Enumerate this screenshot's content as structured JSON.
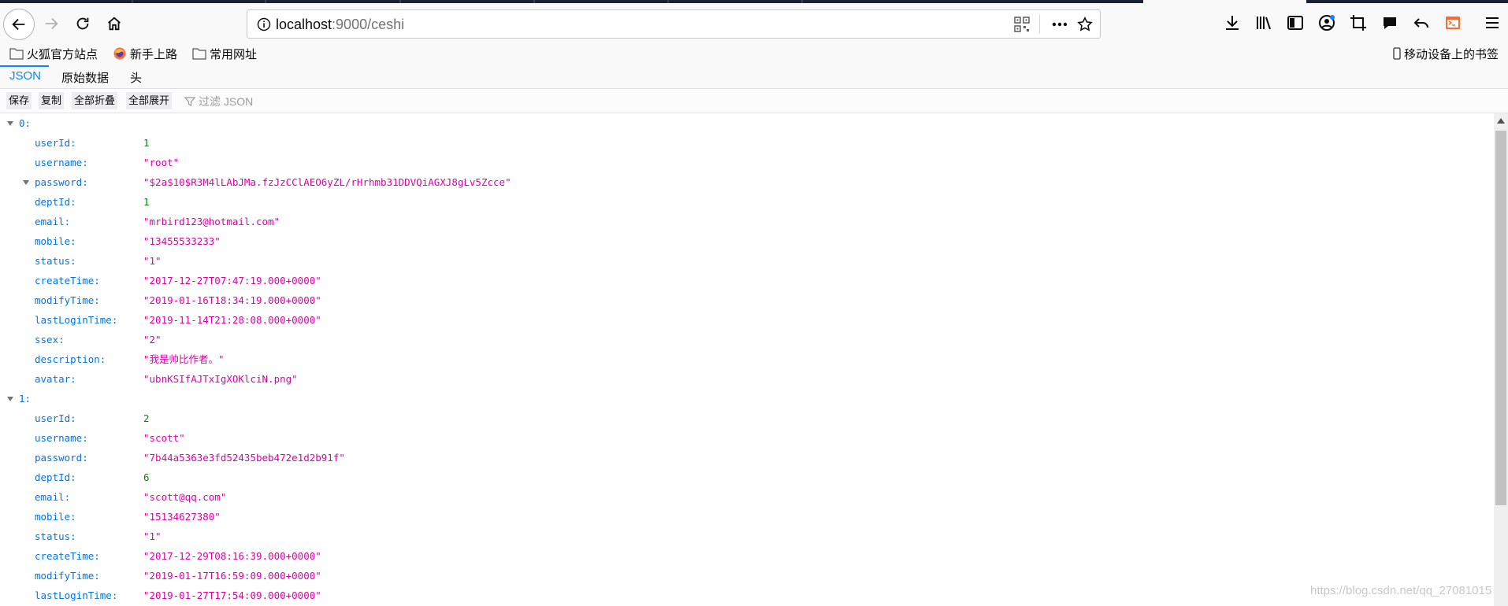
{
  "browser": {
    "url_host": "localhost",
    "url_path": ":9000/ceshi"
  },
  "bookmarks": {
    "items": [
      "火狐官方站点",
      "新手上路",
      "常用网址"
    ],
    "mobile": "移动设备上的书签"
  },
  "viewer_tabs": [
    "JSON",
    "原始数据",
    "头"
  ],
  "toolbar": {
    "save": "保存",
    "copy": "复制",
    "collapse_all": "全部折叠",
    "expand_all": "全部展开",
    "filter_placeholder": "过滤 JSON"
  },
  "records": [
    {
      "index": "0:",
      "fields": [
        {
          "key": "userId:",
          "value": "1",
          "type": "num"
        },
        {
          "key": "username:",
          "value": "\"root\"",
          "type": "str"
        },
        {
          "key": "password:",
          "value": "\"$2a$10$R3M4lLAbJMa.fzJzCClAEO6yZL/rHrhmb31DDVQiAGXJ8gLv5Zcce\"",
          "type": "str",
          "expandable": true
        },
        {
          "key": "deptId:",
          "value": "1",
          "type": "num"
        },
        {
          "key": "email:",
          "value": "\"mrbird123@hotmail.com\"",
          "type": "str"
        },
        {
          "key": "mobile:",
          "value": "\"13455533233\"",
          "type": "str"
        },
        {
          "key": "status:",
          "value": "\"1\"",
          "type": "str"
        },
        {
          "key": "createTime:",
          "value": "\"2017-12-27T07:47:19.000+0000\"",
          "type": "str"
        },
        {
          "key": "modifyTime:",
          "value": "\"2019-01-16T18:34:19.000+0000\"",
          "type": "str"
        },
        {
          "key": "lastLoginTime:",
          "value": "\"2019-11-14T21:28:08.000+0000\"",
          "type": "str"
        },
        {
          "key": "ssex:",
          "value": "\"2\"",
          "type": "str"
        },
        {
          "key": "description:",
          "value": "\"我是帅比作者。\"",
          "type": "str"
        },
        {
          "key": "avatar:",
          "value": "\"ubnKSIfAJTxIgXOKlciN.png\"",
          "type": "str"
        }
      ]
    },
    {
      "index": "1:",
      "fields": [
        {
          "key": "userId:",
          "value": "2",
          "type": "num"
        },
        {
          "key": "username:",
          "value": "\"scott\"",
          "type": "str"
        },
        {
          "key": "password:",
          "value": "\"7b44a5363e3fd52435beb472e1d2b91f\"",
          "type": "str"
        },
        {
          "key": "deptId:",
          "value": "6",
          "type": "num"
        },
        {
          "key": "email:",
          "value": "\"scott@qq.com\"",
          "type": "str"
        },
        {
          "key": "mobile:",
          "value": "\"15134627380\"",
          "type": "str"
        },
        {
          "key": "status:",
          "value": "\"1\"",
          "type": "str"
        },
        {
          "key": "createTime:",
          "value": "\"2017-12-29T08:16:39.000+0000\"",
          "type": "str"
        },
        {
          "key": "modifyTime:",
          "value": "\"2019-01-17T16:59:09.000+0000\"",
          "type": "str"
        },
        {
          "key": "lastLoginTime:",
          "value": "\"2019-01-27T17:54:09.000+0000\"",
          "type": "str"
        }
      ]
    }
  ],
  "watermark": "https://blog.csdn.net/qq_27081015"
}
